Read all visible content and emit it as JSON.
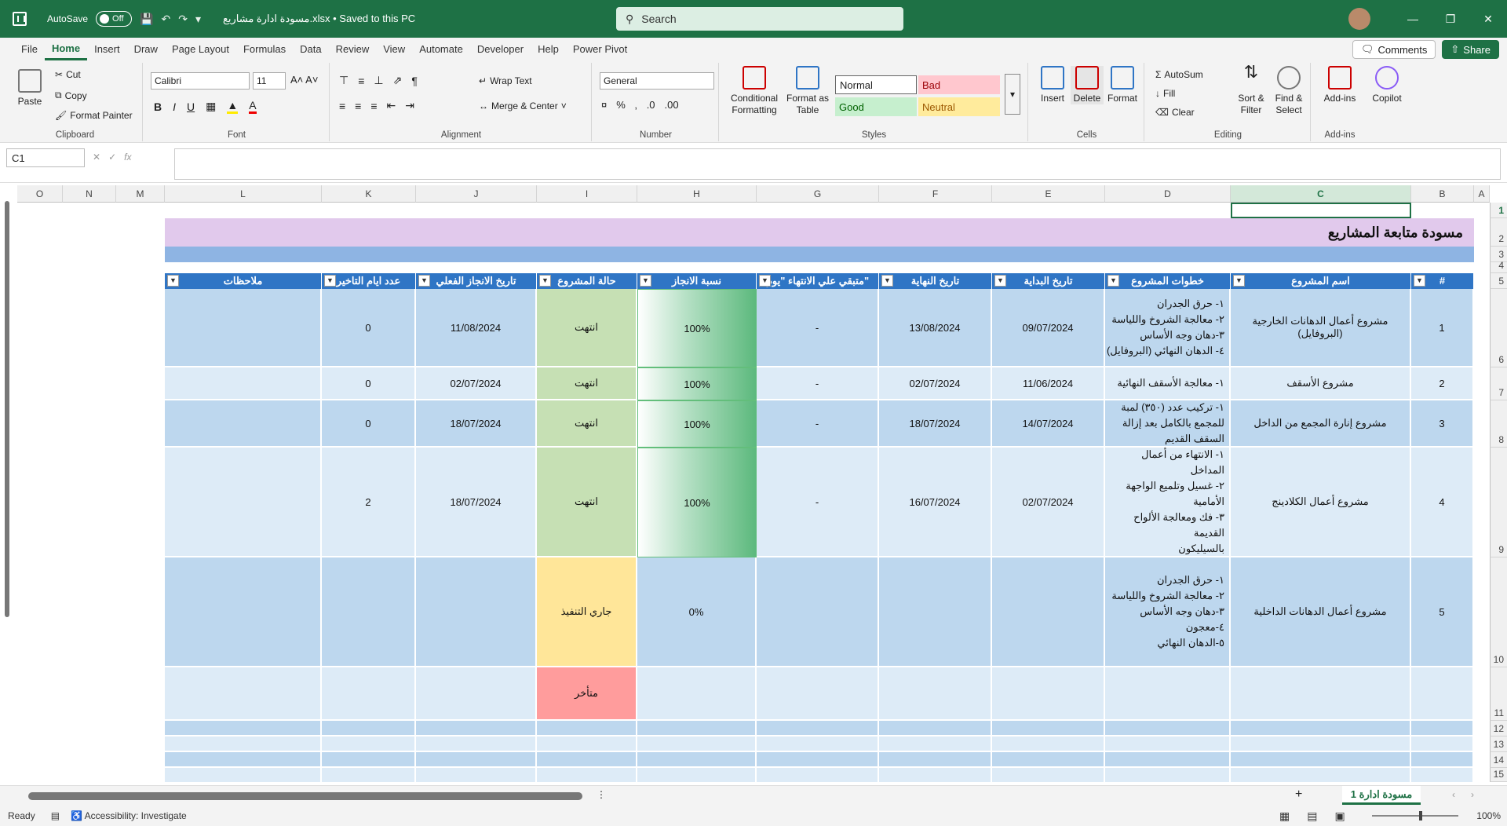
{
  "titlebar": {
    "autosave_label": "AutoSave",
    "autosave_state": "Off",
    "filename": "مسودة ادارة مشاريع.xlsx  •  Saved to this PC",
    "search_placeholder": "Search"
  },
  "menu": [
    "File",
    "Home",
    "Insert",
    "Draw",
    "Page Layout",
    "Formulas",
    "Data",
    "Review",
    "View",
    "Automate",
    "Developer",
    "Help",
    "Power Pivot"
  ],
  "menu_right": {
    "comments": "Comments",
    "share": "Share"
  },
  "ribbon": {
    "clipboard": {
      "paste": "Paste",
      "cut": "Cut",
      "copy": "Copy",
      "format_painter": "Format Painter",
      "label": "Clipboard"
    },
    "font": {
      "name": "Calibri",
      "size": "11",
      "label": "Font"
    },
    "alignment": {
      "wrap": "Wrap Text",
      "merge": "Merge & Center",
      "label": "Alignment"
    },
    "number": {
      "format": "General",
      "label": "Number"
    },
    "styles": {
      "conditional": "Conditional Formatting",
      "format_table": "Format as Table",
      "normal": "Normal",
      "bad": "Bad",
      "good": "Good",
      "neutral": "Neutral",
      "label": "Styles"
    },
    "cells": {
      "insert": "Insert",
      "delete": "Delete",
      "format": "Format",
      "label": "Cells"
    },
    "editing": {
      "autosum": "AutoSum",
      "fill": "Fill",
      "clear": "Clear",
      "sort": "Sort & Filter",
      "find": "Find & Select",
      "label": "Editing"
    },
    "addins": {
      "addins": "Add-ins",
      "label": "Add-ins",
      "copilot": "Copilot"
    }
  },
  "formula_bar": {
    "cell_ref": "C1",
    "formula": ""
  },
  "columns": [
    "O",
    "N",
    "M",
    "L",
    "K",
    "J",
    "I",
    "H",
    "G",
    "F",
    "E",
    "D",
    "C",
    "B",
    "A"
  ],
  "rows": [
    "1",
    "2",
    "3",
    "4",
    "5",
    "6",
    "7",
    "8",
    "9",
    "10",
    "11",
    "12",
    "13",
    "14",
    "15"
  ],
  "sheet": {
    "title": "مسودة متابعة المشاريع",
    "headers": {
      "num": "#",
      "name": "اسم المشروع",
      "steps": "خطوات المشروع",
      "start": "تاريخ البداية",
      "end": "تاريخ النهاية",
      "remaining": "متبقي علي الانتهاء \"يوم\"",
      "pct": "نسبة الانجاز",
      "status": "حالة المشروع",
      "actual": "تاريخ الانجاز الفعلي",
      "delay": "عدد ايام التاخير",
      "notes": "ملاحظات"
    },
    "projects": [
      {
        "num": "1",
        "name": "مشروع أعمال الدهانات الخارجية (البروفايل)",
        "steps": "١- حرق الجدران\n٢- معالجة الشروخ واللياسة\n٣-دهان وجه الأساس\n٤- الدهان النهائي (البروفايل)",
        "start": "09/07/2024",
        "end": "13/08/2024",
        "remaining": "-",
        "pct": "100%",
        "status": "انتهت",
        "actual": "11/08/2024",
        "delay": "0",
        "notes": ""
      },
      {
        "num": "2",
        "name": "مشروع الأسقف",
        "steps": "١- معالجة الأسقف النهائية",
        "start": "11/06/2024",
        "end": "02/07/2024",
        "remaining": "-",
        "pct": "100%",
        "status": "انتهت",
        "actual": "02/07/2024",
        "delay": "0",
        "notes": ""
      },
      {
        "num": "3",
        "name": "مشروع إنارة المجمع من الداخل",
        "steps": "١- تركيب عدد (٣٥٠) لمبة\nللمجمع بالكامل بعد إزالة\nالسقف القديم",
        "start": "14/07/2024",
        "end": "18/07/2024",
        "remaining": "-",
        "pct": "100%",
        "status": "انتهت",
        "actual": "18/07/2024",
        "delay": "0",
        "notes": ""
      },
      {
        "num": "4",
        "name": "مشروع أعمال الكلادينج",
        "steps": "١- الانتهاء من أعمال المداخل\n٢- غسيل وتلميع الواجهة\nالأمامية\n٣- فك ومعالجة الألواح القديمة\nبالسيليكون",
        "start": "02/07/2024",
        "end": "16/07/2024",
        "remaining": "-",
        "pct": "100%",
        "status": "انتهت",
        "actual": "18/07/2024",
        "delay": "2",
        "notes": ""
      },
      {
        "num": "5",
        "name": "مشروع أعمال الدهانات الداخلية",
        "steps": "١- حرق الجدران\n٢- معالجة الشروخ واللياسة\n٣-دهان وجه الأساس\n٤-معجون\n٥-الدهان النهائي",
        "start": "",
        "end": "",
        "remaining": "",
        "pct": "0%",
        "status": "جاري التنفيذ",
        "actual": "",
        "delay": "",
        "notes": ""
      }
    ],
    "late_status": "متأخر"
  },
  "sheet_tab": "مسودة ادارة 1",
  "status": {
    "ready": "Ready",
    "accessibility": "Accessibility: Investigate",
    "zoom": "100%"
  },
  "colors": {
    "title_green": "#1e7145",
    "header_blue": "#2f75c5",
    "band_purple": "#e1c9ec",
    "row_dark": "#bdd7ee",
    "row_light": "#ddebf7",
    "done": "#c6e0b4",
    "in_progress": "#ffe699",
    "late": "#ff9c9c"
  }
}
